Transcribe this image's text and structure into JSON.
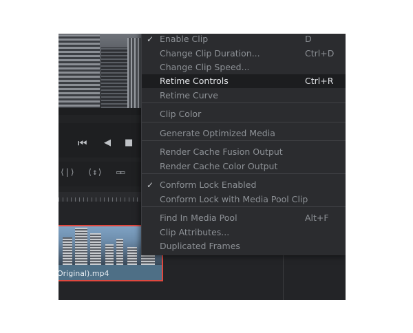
{
  "menu": {
    "items": [
      {
        "label": "Enable Clip",
        "shortcut": "D",
        "checked": true
      },
      {
        "label": "Change Clip Duration...",
        "shortcut": "Ctrl+D",
        "checked": false
      },
      {
        "label": "Change Clip Speed...",
        "shortcut": "",
        "checked": false
      },
      {
        "label": "Retime Controls",
        "shortcut": "Ctrl+R",
        "checked": false,
        "highlighted": true
      },
      {
        "label": "Retime Curve",
        "shortcut": "",
        "checked": false
      },
      {
        "label": "Clip Color",
        "shortcut": "",
        "checked": false
      },
      {
        "label": "Generate Optimized Media",
        "shortcut": "",
        "checked": false
      },
      {
        "label": "Render Cache Fusion Output",
        "shortcut": "",
        "checked": false
      },
      {
        "label": "Render Cache Color Output",
        "shortcut": "",
        "checked": false
      },
      {
        "label": "Conform Lock Enabled",
        "shortcut": "",
        "checked": true
      },
      {
        "label": "Conform Lock with Media Pool Clip",
        "shortcut": "",
        "checked": false
      },
      {
        "label": "Find In Media Pool",
        "shortcut": "Alt+F",
        "checked": false
      },
      {
        "label": "Clip Attributes...",
        "shortcut": "",
        "checked": false
      },
      {
        "label": "Duplicated Frames",
        "shortcut": "",
        "checked": false
      }
    ],
    "check_glyph": "✓"
  },
  "transport": {
    "skip_back_icon": "⏮",
    "play_reverse_icon": "◀",
    "stop_icon": "■"
  },
  "tools": {
    "trim_icon": "⟨|⟩",
    "dynamic_trim_icon": "⟨↕⟩",
    "snapping_icon": "▭▭"
  },
  "clip": {
    "name": "Original).mp4",
    "selected_color": "#e0483f"
  },
  "colors": {
    "menu_bg": "#2b2c2f",
    "highlight_bg": "#1c1d1f"
  }
}
